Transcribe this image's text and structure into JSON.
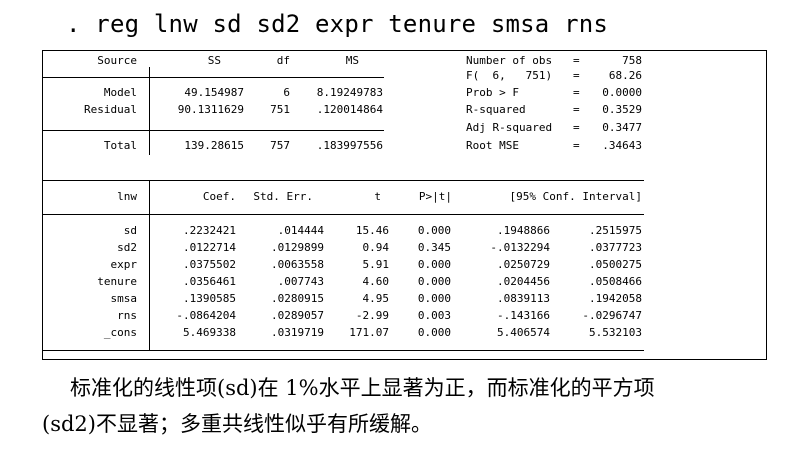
{
  "command": ". reg lnw sd sd2 expr tenure smsa rns",
  "anova": {
    "headers": [
      "Source",
      "SS",
      "df",
      "MS"
    ],
    "rows": [
      {
        "source": "Model",
        "ss": "49.154987",
        "df": "6",
        "ms": "8.19249783"
      },
      {
        "source": "Residual",
        "ss": "90.1311629",
        "df": "751",
        "ms": ".120014864"
      },
      {
        "source": "Total",
        "ss": "139.28615",
        "df": "757",
        "ms": ".183997556"
      }
    ]
  },
  "stats": [
    {
      "label": "Number of obs",
      "eq": "=",
      "value": "758"
    },
    {
      "label": "F(  6,   751)",
      "eq": "=",
      "value": "68.26"
    },
    {
      "label": "Prob > F",
      "eq": "=",
      "value": "0.0000"
    },
    {
      "label": "R-squared",
      "eq": "=",
      "value": "0.3529"
    },
    {
      "label": "Adj R-squared",
      "eq": "=",
      "value": "0.3477"
    },
    {
      "label": "Root MSE",
      "eq": "=",
      "value": ".34643"
    }
  ],
  "coef": {
    "headers": [
      "lnw",
      "Coef.",
      "Std. Err.",
      "t",
      "P>|t|",
      "[95% Conf. Interval]"
    ],
    "rows": [
      {
        "var": "sd",
        "coef": ".2232421",
        "se": ".014444",
        "t": "15.46",
        "p": "0.000",
        "lo": ".1948866",
        "hi": ".2515975"
      },
      {
        "var": "sd2",
        "coef": ".0122714",
        "se": ".0129899",
        "t": "0.94",
        "p": "0.345",
        "lo": "-.0132294",
        "hi": ".0377723"
      },
      {
        "var": "expr",
        "coef": ".0375502",
        "se": ".0063558",
        "t": "5.91",
        "p": "0.000",
        "lo": ".0250729",
        "hi": ".0500275"
      },
      {
        "var": "tenure",
        "coef": ".0356461",
        "se": ".007743",
        "t": "4.60",
        "p": "0.000",
        "lo": ".0204456",
        "hi": ".0508466"
      },
      {
        "var": "smsa",
        "coef": ".1390585",
        "se": ".0280915",
        "t": "4.95",
        "p": "0.000",
        "lo": ".0839113",
        "hi": ".1942058"
      },
      {
        "var": "rns",
        "coef": "-.0864204",
        "se": ".0289057",
        "t": "-2.99",
        "p": "0.003",
        "lo": "-.143166",
        "hi": "-.0296747"
      },
      {
        "var": "_cons",
        "coef": "5.469338",
        "se": ".0319719",
        "t": "171.07",
        "p": "0.000",
        "lo": "5.406574",
        "hi": "5.532103"
      }
    ]
  },
  "caption": {
    "line1": "标准化的线性项(sd)在 1%水平上显著为正，而标准化的平方项",
    "line2": "(sd2)不显著；多重共线性似乎有所缓解。"
  }
}
